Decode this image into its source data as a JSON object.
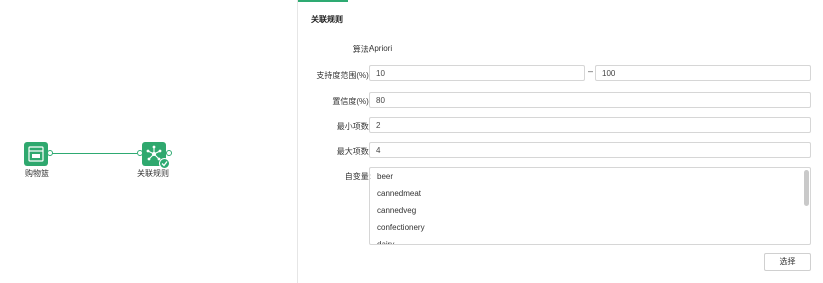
{
  "canvas": {
    "nodes": [
      {
        "label": "购物篮",
        "icon": "basket-data-icon",
        "glyph": "DB"
      },
      {
        "label": "关联规则",
        "icon": "association-rules-icon",
        "status": "success"
      }
    ]
  },
  "panel": {
    "title": "关联规则",
    "algorithm": {
      "label": "算法:",
      "value": "Apriori"
    },
    "support": {
      "label": "支持度范围(%):",
      "min": "10",
      "max": "100",
      "separator": "–"
    },
    "confidence": {
      "label": "置信度(%):",
      "value": "80"
    },
    "min_items": {
      "label": "最小项数:",
      "value": "2"
    },
    "max_items": {
      "label": "最大项数:",
      "value": "4"
    },
    "variables": {
      "label": "自变量:",
      "items": [
        "beer",
        "cannedmeat",
        "cannedveg",
        "confectionery",
        "dairy"
      ]
    },
    "select_button": "选择"
  },
  "colors": {
    "accent": "#2eaa72",
    "border": "#d6d6d6"
  }
}
